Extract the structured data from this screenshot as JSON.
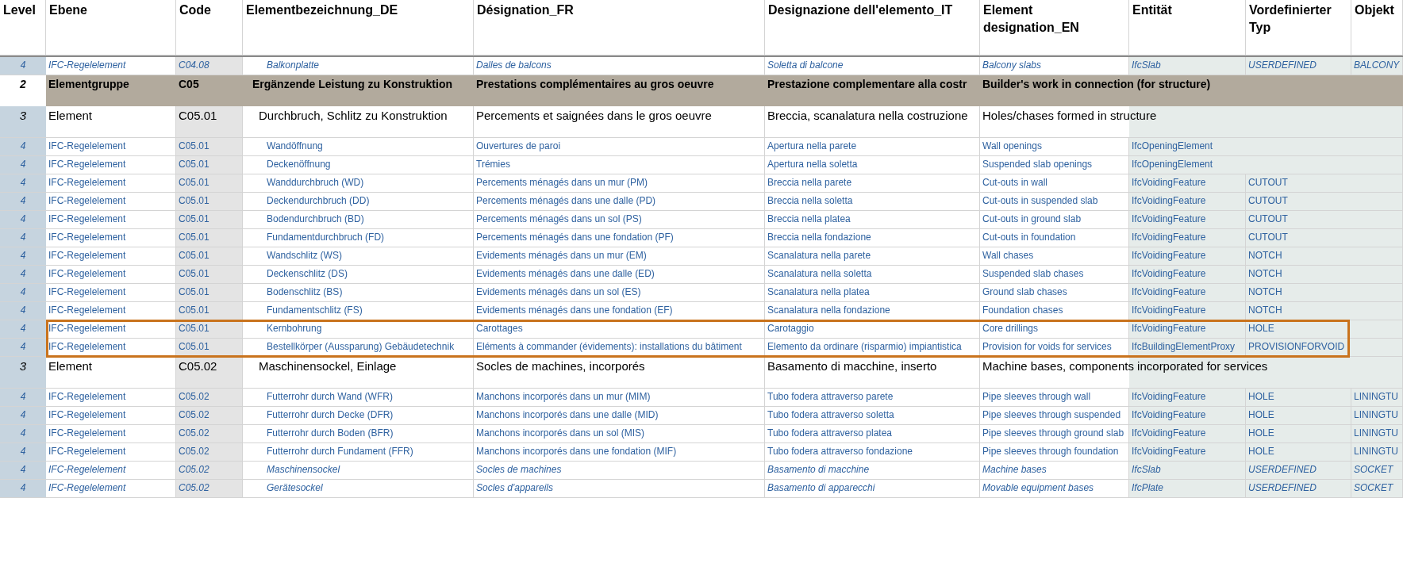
{
  "columns": [
    "Level",
    "Ebene",
    "Code",
    "Elementbezeichnung_DE",
    "Désignation_FR",
    "Designazione dell'elemento_IT",
    "Element designation_EN",
    "Entität",
    "Vordefinierter Typ",
    "Objekt"
  ],
  "rows": [
    {
      "kind": "ifc",
      "italic": true,
      "highlighted": false,
      "level": "4",
      "ebene": "IFC-Regelelement",
      "code": "C04.08",
      "de": "Balkonplatte",
      "fr": "Dalles de balcons",
      "it": "Soletta di balcone",
      "en": "Balcony slabs",
      "entity": "IfcSlab",
      "type": "USERDEFINED",
      "object": "BALCONY"
    },
    {
      "kind": "group",
      "highlighted": false,
      "level": "2",
      "ebene": "Elementgruppe",
      "code": "C05",
      "de": "Ergänzende Leistung zu Konstruktion",
      "fr": "Prestations complémentaires au gros oeuvre",
      "it": "Prestazione complementare alla costr",
      "en": "Builder's work in connection (for structure)"
    },
    {
      "kind": "element",
      "highlighted": false,
      "level": "3",
      "ebene": "Element",
      "code": "C05.01",
      "de": "Durchbruch, Schlitz zu Konstruktion",
      "fr": "Percements et saignées dans le gros oeuvre",
      "it": "Breccia, scanalatura nella costruzione",
      "en": "Holes/chases formed in structure"
    },
    {
      "kind": "ifc",
      "italic": false,
      "highlighted": false,
      "level": "4",
      "ebene": "IFC-Regelelement",
      "code": "C05.01",
      "de": "Wandöffnung",
      "fr": "Ouvertures de paroi",
      "it": "Apertura nella parete",
      "en": "Wall openings",
      "entity": "IfcOpeningElement"
    },
    {
      "kind": "ifc",
      "italic": false,
      "highlighted": false,
      "level": "4",
      "ebene": "IFC-Regelelement",
      "code": "C05.01",
      "de": "Deckenöffnung",
      "fr": "Trémies",
      "it": "Apertura nella soletta",
      "en": "Suspended slab openings",
      "entity": "IfcOpeningElement"
    },
    {
      "kind": "ifc",
      "italic": false,
      "highlighted": false,
      "level": "4",
      "ebene": "IFC-Regelelement",
      "code": "C05.01",
      "de": "Wanddurchbruch (WD)",
      "fr": "Percements ménagés dans un mur (PM)",
      "it": "Breccia nella parete",
      "en": "Cut-outs in wall",
      "entity": "IfcVoidingFeature",
      "type": "CUTOUT"
    },
    {
      "kind": "ifc",
      "italic": false,
      "highlighted": false,
      "level": "4",
      "ebene": "IFC-Regelelement",
      "code": "C05.01",
      "de": "Deckendurchbruch (DD)",
      "fr": "Percements ménagés dans une dalle (PD)",
      "it": "Breccia nella soletta",
      "en": "Cut-outs in suspended slab",
      "entity": "IfcVoidingFeature",
      "type": "CUTOUT"
    },
    {
      "kind": "ifc",
      "italic": false,
      "highlighted": false,
      "level": "4",
      "ebene": "IFC-Regelelement",
      "code": "C05.01",
      "de": "Bodendurchbruch (BD)",
      "fr": "Percements ménagés dans un sol (PS)",
      "it": "Breccia nella platea",
      "en": "Cut-outs in ground slab",
      "entity": "IfcVoidingFeature",
      "type": "CUTOUT"
    },
    {
      "kind": "ifc",
      "italic": false,
      "highlighted": false,
      "level": "4",
      "ebene": "IFC-Regelelement",
      "code": "C05.01",
      "de": "Fundamentdurchbruch (FD)",
      "fr": "Percements ménagés dans une fondation (PF)",
      "it": "Breccia nella fondazione",
      "en": "Cut-outs in foundation",
      "entity": "IfcVoidingFeature",
      "type": "CUTOUT"
    },
    {
      "kind": "ifc",
      "italic": false,
      "highlighted": false,
      "level": "4",
      "ebene": "IFC-Regelelement",
      "code": "C05.01",
      "de": "Wandschlitz (WS)",
      "fr": "Evidements ménagés dans un mur (EM)",
      "it": "Scanalatura nella parete",
      "en": "Wall chases",
      "entity": "IfcVoidingFeature",
      "type": "NOTCH"
    },
    {
      "kind": "ifc",
      "italic": false,
      "highlighted": false,
      "level": "4",
      "ebene": "IFC-Regelelement",
      "code": "C05.01",
      "de": "Deckenschlitz (DS)",
      "fr": "Evidements ménagés dans une dalle (ED)",
      "it": "Scanalatura nella soletta",
      "en": "Suspended slab chases",
      "entity": "IfcVoidingFeature",
      "type": "NOTCH"
    },
    {
      "kind": "ifc",
      "italic": false,
      "highlighted": false,
      "level": "4",
      "ebene": "IFC-Regelelement",
      "code": "C05.01",
      "de": "Bodenschlitz (BS)",
      "fr": "Evidements ménagés dans un sol (ES)",
      "it": "Scanalatura nella platea",
      "en": "Ground slab chases",
      "entity": "IfcVoidingFeature",
      "type": "NOTCH"
    },
    {
      "kind": "ifc",
      "italic": false,
      "highlighted": false,
      "level": "4",
      "ebene": "IFC-Regelelement",
      "code": "C05.01",
      "de": "Fundamentschlitz (FS)",
      "fr": "Evidements ménagés dans une fondation (EF)",
      "it": "Scanalatura nella fondazione",
      "en": "Foundation chases",
      "entity": "IfcVoidingFeature",
      "type": "NOTCH"
    },
    {
      "kind": "ifc",
      "italic": false,
      "highlighted": true,
      "level": "4",
      "ebene": "IFC-Regelelement",
      "code": "C05.01",
      "de": "Kernbohrung",
      "fr": "Carottages",
      "it": "Carotaggio",
      "en": "Core drillings",
      "entity": "IfcVoidingFeature",
      "type": "HOLE"
    },
    {
      "kind": "ifc",
      "italic": false,
      "highlighted": true,
      "level": "4",
      "ebene": "IFC-Regelelement",
      "code": "C05.01",
      "de": "Bestellkörper (Aussparung) Gebäudetechnik",
      "fr": "Eléments à commander (évidements): installations du bâtiment",
      "it": "Elemento da ordinare (risparmio) impiantistica",
      "en": "Provision for voids for services",
      "entity": "IfcBuildingElementProxy",
      "type": "PROVISIONFORVOID"
    },
    {
      "kind": "element",
      "highlighted": false,
      "level": "3",
      "ebene": "Element",
      "code": "C05.02",
      "de": "Maschinensockel, Einlage",
      "fr": "Socles de machines, incorporés",
      "it": "Basamento di macchine, inserto",
      "en": "Machine bases, components incorporated for services"
    },
    {
      "kind": "ifc",
      "italic": false,
      "highlighted": false,
      "level": "4",
      "ebene": "IFC-Regelelement",
      "code": "C05.02",
      "de": "Futterrohr durch Wand (WFR)",
      "fr": "Manchons incorporés dans un mur (MIM)",
      "it": "Tubo fodera attraverso parete",
      "en": "Pipe sleeves through wall",
      "entity": "IfcVoidingFeature",
      "type": "HOLE",
      "object": "LININGTU"
    },
    {
      "kind": "ifc",
      "italic": false,
      "highlighted": false,
      "level": "4",
      "ebene": "IFC-Regelelement",
      "code": "C05.02",
      "de": "Futterrohr durch Decke (DFR)",
      "fr": "Manchons incorporés dans une dalle (MID)",
      "it": "Tubo fodera attraverso soletta",
      "en": "Pipe sleeves through suspended",
      "entity": "IfcVoidingFeature",
      "type": "HOLE",
      "object": "LININGTU"
    },
    {
      "kind": "ifc",
      "italic": false,
      "highlighted": false,
      "level": "4",
      "ebene": "IFC-Regelelement",
      "code": "C05.02",
      "de": "Futterrohr durch Boden (BFR)",
      "fr": "Manchons incorporés dans un sol (MIS)",
      "it": "Tubo fodera attraverso platea",
      "en": "Pipe sleeves through ground slab",
      "entity": "IfcVoidingFeature",
      "type": "HOLE",
      "object": "LININGTU"
    },
    {
      "kind": "ifc",
      "italic": false,
      "highlighted": false,
      "level": "4",
      "ebene": "IFC-Regelelement",
      "code": "C05.02",
      "de": "Futterrohr durch Fundament (FFR)",
      "fr": "Manchons incorporés dans une fondation (MIF)",
      "it": "Tubo fodera attraverso fondazione",
      "en": "Pipe sleeves through foundation",
      "entity": "IfcVoidingFeature",
      "type": "HOLE",
      "object": "LININGTU"
    },
    {
      "kind": "ifc",
      "italic": true,
      "highlighted": false,
      "level": "4",
      "ebene": "IFC-Regelelement",
      "code": "C05.02",
      "de": "Maschinensockel",
      "fr": "Socles de machines",
      "it": "Basamento di macchine",
      "en": "Machine bases",
      "entity": "IfcSlab",
      "type": "USERDEFINED",
      "object": "SOCKET"
    },
    {
      "kind": "ifc",
      "italic": true,
      "highlighted": false,
      "level": "4",
      "ebene": "IFC-Regelelement",
      "code": "C05.02",
      "de": "Gerätesockel",
      "fr": "Socles d'appareils",
      "it": "Basamento di apparecchi",
      "en": "Movable equipment bases",
      "entity": "IfcPlate",
      "type": "USERDEFINED",
      "object": "SOCKET"
    }
  ]
}
